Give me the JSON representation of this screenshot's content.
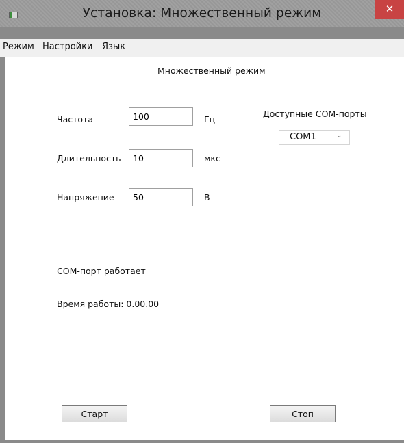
{
  "window": {
    "title": "Установка: Множественный режим",
    "close_glyph": "✕"
  },
  "menu": {
    "items": [
      "Режим",
      "Настройки",
      "Язык"
    ]
  },
  "main": {
    "heading": "Множественный режим",
    "fields": [
      {
        "label": "Частота",
        "value": "100",
        "unit": "Гц"
      },
      {
        "label": "Длительность",
        "value": "10",
        "unit": "мкс"
      },
      {
        "label": "Напряжение",
        "value": "50",
        "unit": "В"
      }
    ],
    "ports": {
      "label": "Доступные COM-порты",
      "selected": "COM1"
    },
    "status_text": "COM-порт работает",
    "runtime_text": "Время работы: 0.00.00",
    "start_button": "Старт",
    "stop_button": "Стоп"
  },
  "icons": {
    "app": "app-window-icon",
    "close": "close-icon",
    "dropdown": "chevron-down-icon"
  },
  "colors": {
    "titlebar": "#9c9c9c",
    "close_button": "#c84343",
    "menubar": "#f0f0f0",
    "client": "#ffffff"
  }
}
